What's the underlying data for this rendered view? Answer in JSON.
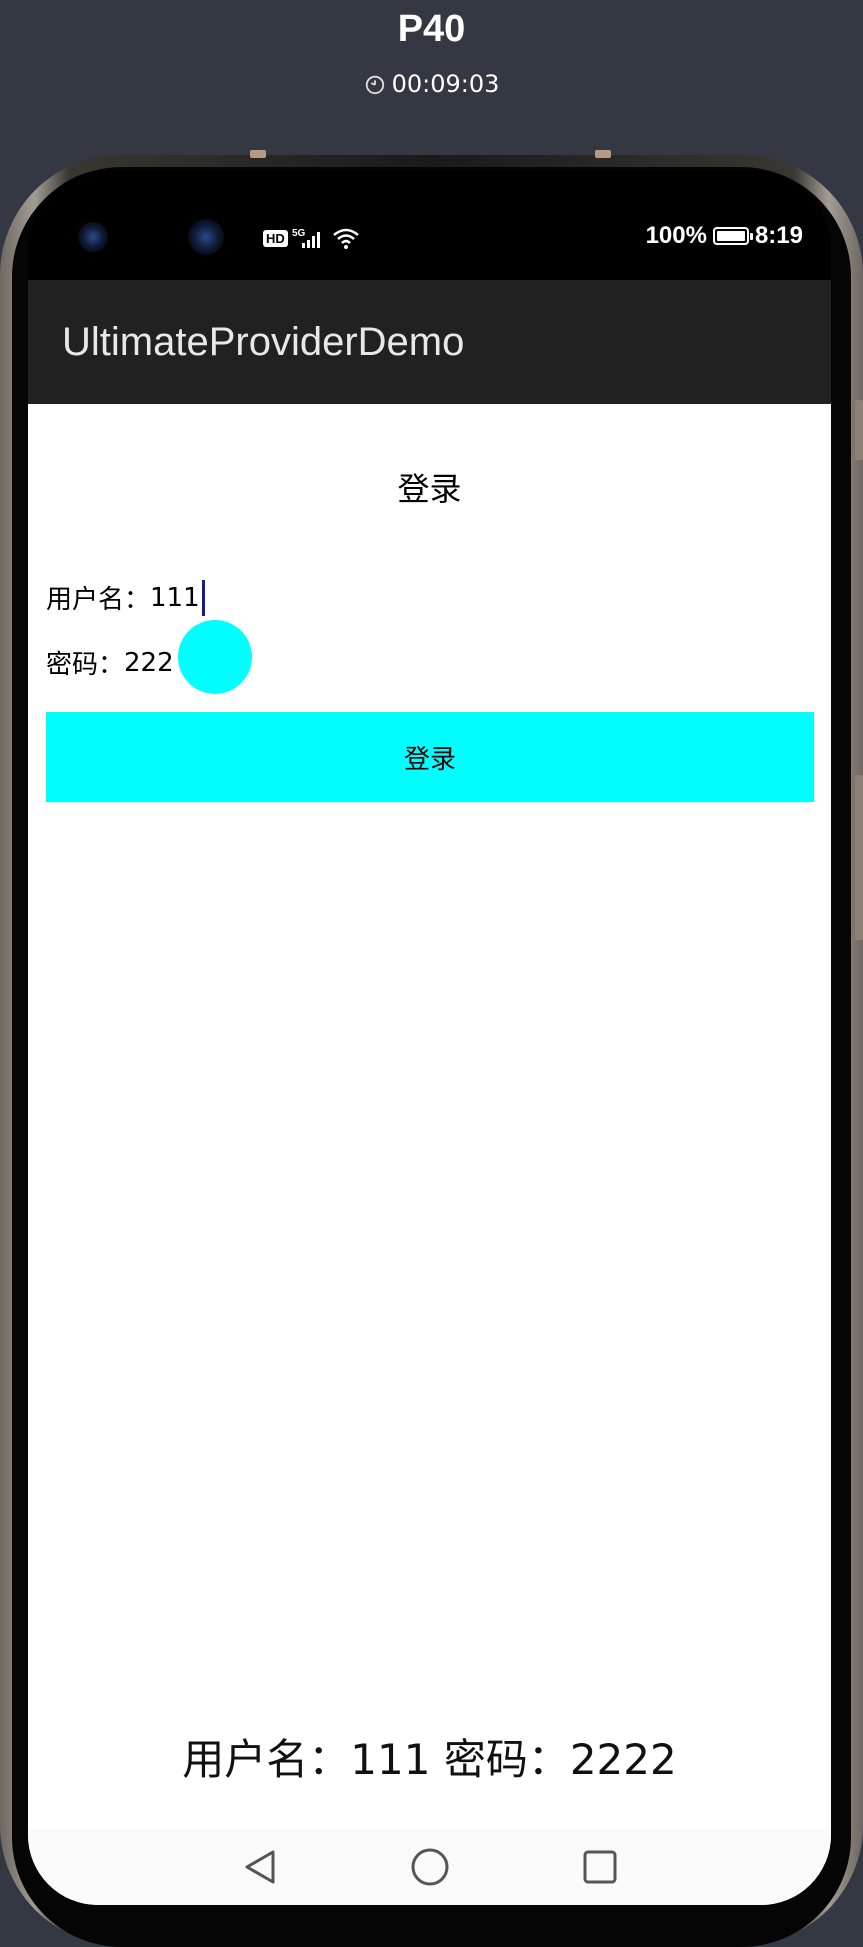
{
  "header": {
    "device_name": "P40",
    "timer": "00:09:03",
    "timer_icon": "timer-icon"
  },
  "status_bar": {
    "hd_label": "HD",
    "network_label": "5G",
    "battery_percent": "100%",
    "time": "8:19",
    "battery_level": 1.0
  },
  "app_bar": {
    "title": "UltimateProviderDemo"
  },
  "form": {
    "title": "登录",
    "username_label": "用户名：",
    "username_value": "111",
    "password_label": "密码：",
    "password_value": "222",
    "login_button": "登录"
  },
  "result": {
    "text": "用户名：111  密码：2222"
  },
  "nav": {
    "back_icon": "back-triangle-icon",
    "home_icon": "home-circle-icon",
    "recents_icon": "recents-square-icon"
  },
  "colors": {
    "accent": "#00ffff",
    "app_bar": "#212121",
    "background": "#343842"
  }
}
